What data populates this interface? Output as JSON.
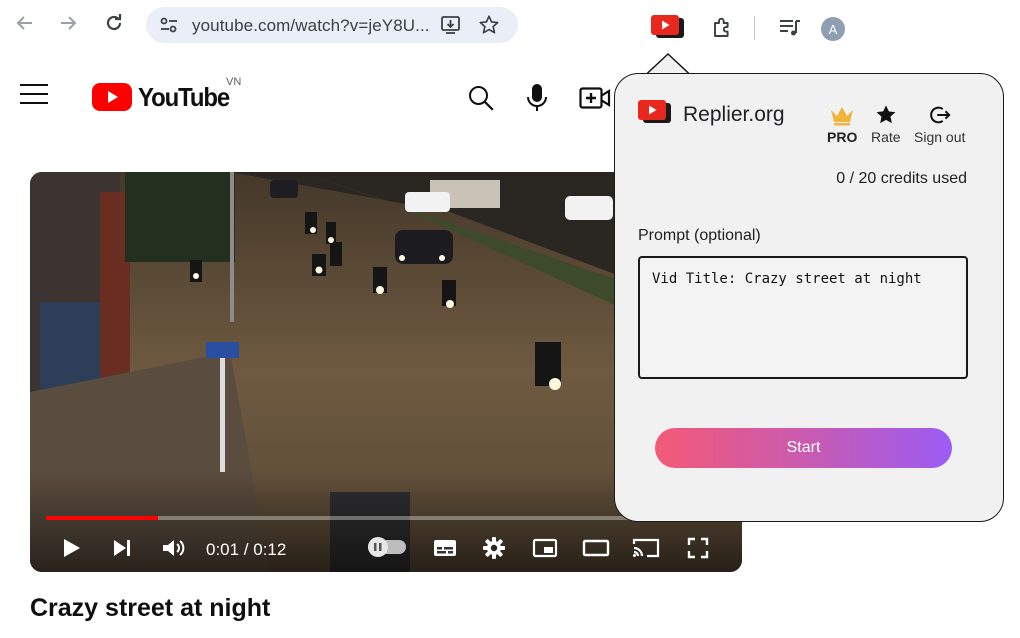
{
  "browser": {
    "url": "youtube.com/watch?v=jeY8U...",
    "profile_initial": "A"
  },
  "youtube": {
    "logo_text": "YouTube",
    "country_code": "VN",
    "video": {
      "title": "Crazy street at night",
      "time_display": "0:01 / 0:12",
      "progress_fraction": 0.165
    }
  },
  "popup": {
    "brand": "Replier.org",
    "actions": [
      {
        "label": "PRO",
        "icon": "crown-icon"
      },
      {
        "label": "Rate",
        "icon": "star-icon"
      },
      {
        "label": "Sign out",
        "icon": "sign-out-icon"
      }
    ],
    "credits": "0 / 20 credits used",
    "prompt_label": "Prompt (optional)",
    "prompt_value": "Vid Title: Crazy street at night",
    "start_label": "Start"
  },
  "colors": {
    "youtube_red": "#ff0000",
    "crown_gold": "#f2b33d",
    "start_gradient_from": "#f35a76",
    "start_gradient_to": "#9b5cf5",
    "popup_background": "#f1f1f1"
  }
}
